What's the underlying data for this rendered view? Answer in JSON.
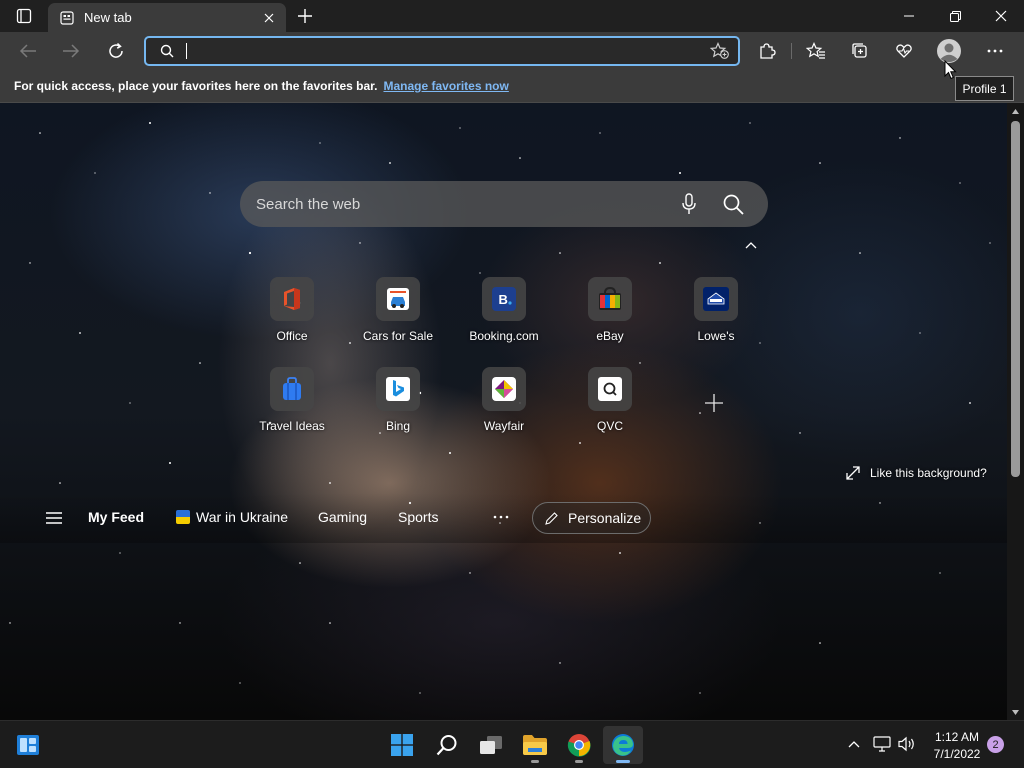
{
  "browser": {
    "tab": {
      "title": "New tab",
      "icon": "new-tab-page-icon"
    },
    "address": {
      "value": "",
      "placeholder": ""
    },
    "favorites_bar": {
      "text": "For quick access, place your favorites here on the favorites bar.",
      "link": "Manage favorites now"
    },
    "profile_tooltip": "Profile 1",
    "accent_color": "#75b7f0"
  },
  "newtab": {
    "search_placeholder": "Search the web",
    "tiles": [
      {
        "label": "Office",
        "icon": "office-icon"
      },
      {
        "label": "Cars for Sale",
        "icon": "cars-for-sale-icon"
      },
      {
        "label": "Booking.com",
        "icon": "booking-icon"
      },
      {
        "label": "eBay",
        "icon": "ebay-icon"
      },
      {
        "label": "Lowe's",
        "icon": "lowes-icon"
      },
      {
        "label": "Travel Ideas",
        "icon": "travel-ideas-icon"
      },
      {
        "label": "Bing",
        "icon": "bing-icon"
      },
      {
        "label": "Wayfair",
        "icon": "wayfair-icon"
      },
      {
        "label": "QVC",
        "icon": "qvc-icon"
      }
    ],
    "background_link": "Like this background?",
    "feed": {
      "items": [
        "My Feed",
        "War in Ukraine",
        "Gaming",
        "Sports"
      ],
      "personalize": "Personalize"
    }
  },
  "taskbar": {
    "time": "1:12 AM",
    "date": "7/1/2022",
    "notifications": "2"
  }
}
